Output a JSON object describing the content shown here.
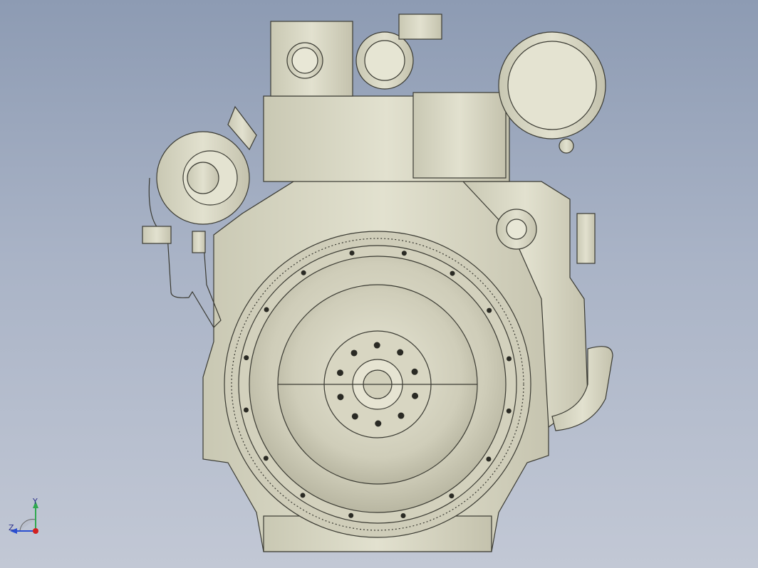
{
  "viewport": {
    "background_top": "#8d9bb3",
    "background_bottom": "#c2c8d5",
    "model_color": "#d9d8c6",
    "model_shadow": "#a9a893",
    "edge_color": "#3a3a32"
  },
  "triad": {
    "y_label": "Y",
    "z_label": "Z",
    "y_color": "#2fa84f",
    "z_color": "#2b4fd0",
    "origin_color": "#d22020"
  }
}
